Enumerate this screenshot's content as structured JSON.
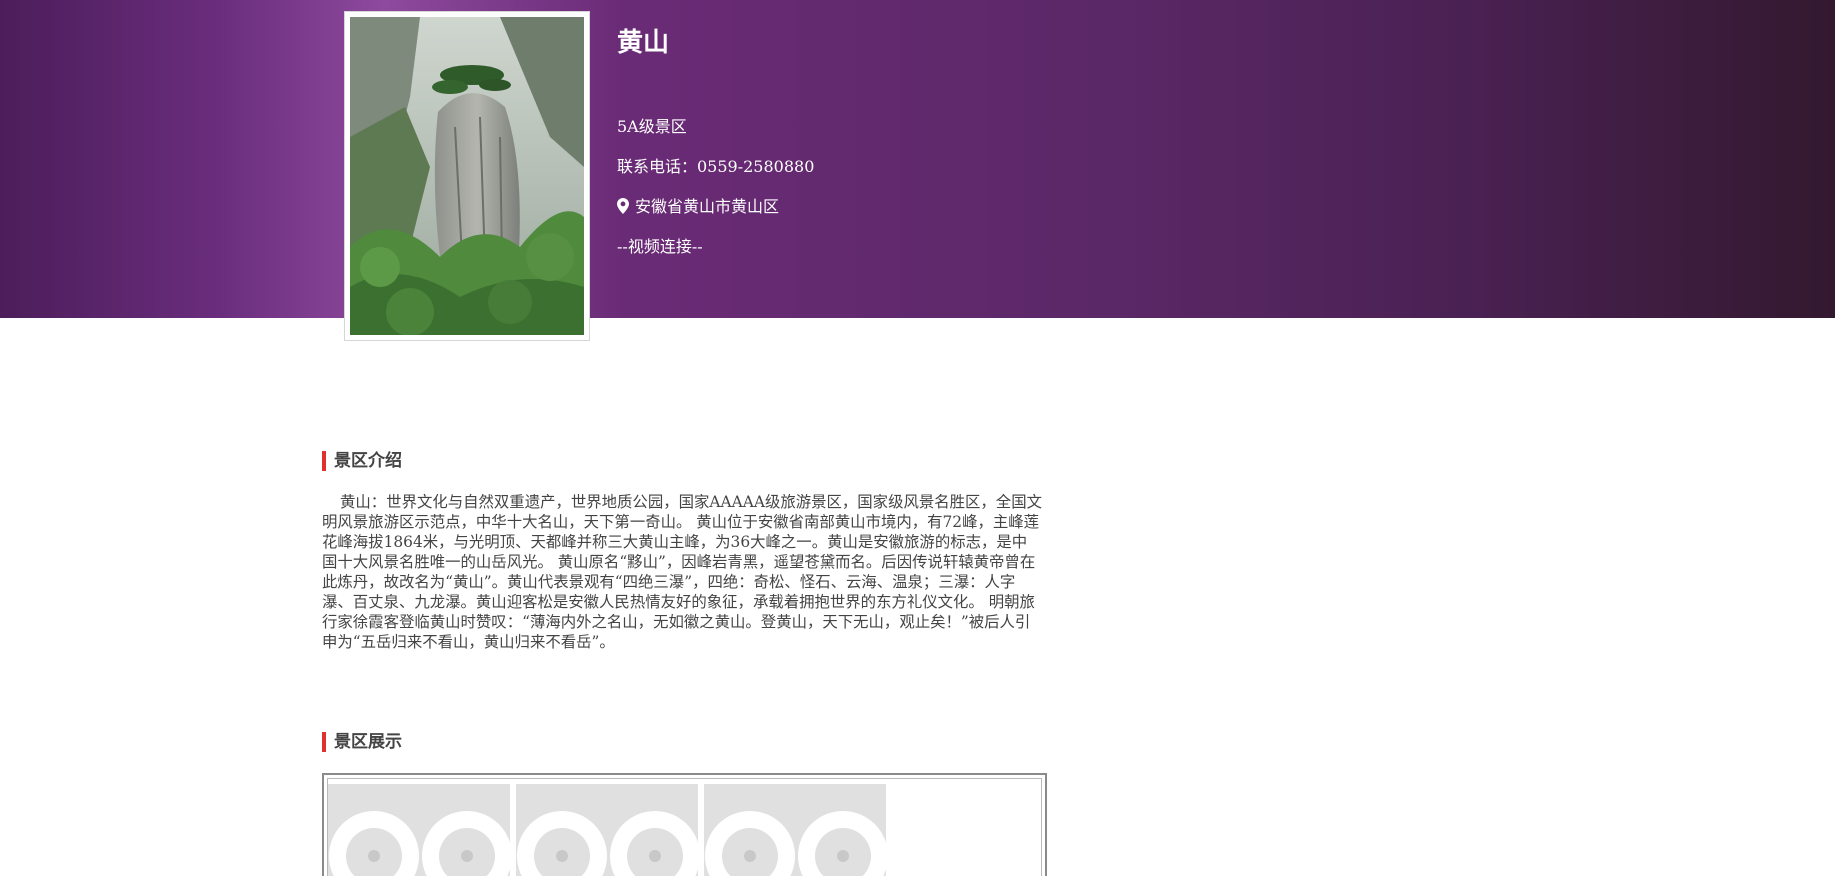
{
  "scenic": {
    "name": "黄山",
    "level": "5A级景区",
    "phone": "联系电话：0559-2580880",
    "address": "安徽省黄山市黄山区",
    "video_link": "--视频连接--",
    "location_icon": "map-marker-icon"
  },
  "intro_section": {
    "title": "景区介绍",
    "text": "黄山：世界文化与自然双重遗产，世界地质公园，国家AAAAA级旅游景区，国家级风景名胜区，全国文明风景旅游区示范点，中华十大名山，天下第一奇山。 黄山位于安徽省南部黄山市境内，有72峰，主峰莲花峰海拔1864米，与光明顶、天都峰并称三大黄山主峰，为36大峰之一。黄山是安徽旅游的标志，是中国十大风景名胜唯一的山岳风光。 黄山原名“黟山”，因峰岩青黑，遥望苍黛而名。后因传说轩辕黄帝曾在此炼丹，故改名为“黄山”。黄山代表景观有“四绝三瀑”，四绝：奇松、怪石、云海、温泉；三瀑：人字瀑、百丈泉、九龙瀑。黄山迎客松是安徽人民热情友好的象征，承载着拥抱世界的东方礼仪文化。 明朝旅行家徐霞客登临黄山时赞叹：“薄海内外之名山，无如徽之黄山。登黄山，天下无山，观止矣！”被后人引申为“五岳归来不看山，黄山归来不看岳”。"
  },
  "gallery_section": {
    "title": "景区展示",
    "thumbnail_icon": "image-placeholder-icon",
    "thumbnail_count": 3
  },
  "colors": {
    "accent": "#e0312f",
    "hero_light": "#8e4a9e",
    "hero_dark": "#33192f",
    "placeholder": "#e0e0e0"
  }
}
